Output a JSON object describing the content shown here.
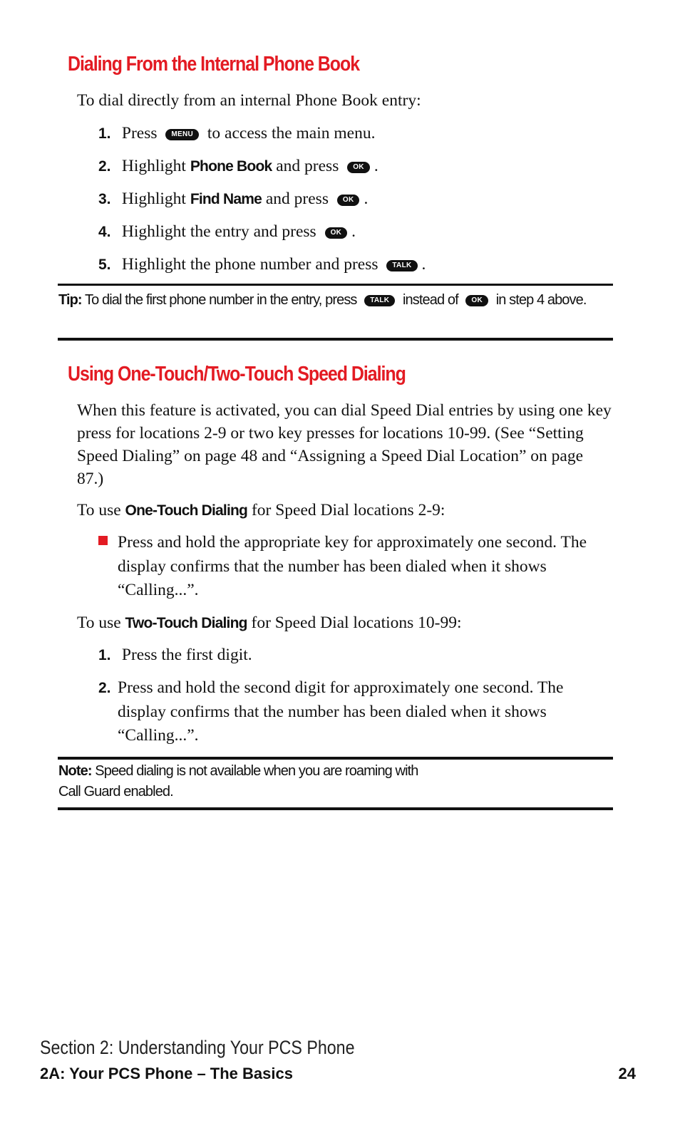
{
  "section1": {
    "heading": "Dialing From the Internal Phone Book",
    "intro": "To dial directly from an internal Phone Book entry:",
    "steps": [
      {
        "num": "1.",
        "pre": "Press",
        "key": "MENU",
        "post": "to access the main menu."
      },
      {
        "num": "2.",
        "pre": "Highlight",
        "bold": "Phone Book",
        "mid": "and press",
        "key": "OK",
        "post": "."
      },
      {
        "num": "3.",
        "pre": "Highlight",
        "bold": "Find Name",
        "mid": "and press",
        "key": "OK",
        "post": "."
      },
      {
        "num": "4.",
        "pre": "Highlight the entry and press",
        "key": "OK",
        "post": "."
      },
      {
        "num": "5.",
        "pre": "Highlight the phone number and press",
        "key": "TALK",
        "post": "."
      }
    ],
    "tip": {
      "label": "Tip:",
      "text1": "To dial the first phone number in the entry, press",
      "key1": "TALK",
      "text2": "instead of",
      "key2": "OK",
      "text3": "in step 4 above."
    }
  },
  "section2": {
    "heading": "Using One-Touch/Two-Touch Speed Dialing",
    "intro": "When this feature is activated, you can dial Speed Dial entries by using one key press for locations 2-9 or two key presses for locations 10-99. (See “Setting Speed Dialing” on page 48 and “Assigning a Speed Dial Location” on page 87.)",
    "one_touch": {
      "pre": "To use",
      "bold": "One-Touch Dialing",
      "post": "for Speed Dial locations 2-9:",
      "bullet": "Press and hold the appropriate key for approximately one second. The display confirms that the number has been dialed when it shows “Calling...”."
    },
    "two_touch": {
      "pre": "To use",
      "bold": "Two-Touch Dialing",
      "post": "for Speed Dial locations 10-99:",
      "steps": [
        {
          "num": "1.",
          "text": "Press the first digit."
        },
        {
          "num": "2.",
          "text": "Press and hold the second digit for approximately one second. The display confirms that the number has been dialed when it shows “Calling...”."
        }
      ]
    },
    "note": {
      "label": "Note:",
      "line1": "Speed dialing is not available when you are roaming with",
      "line2": "Call Guard enabled."
    }
  },
  "footer": {
    "section": "Section 2: Understanding Your PCS Phone",
    "chapter": "2A: Your PCS Phone – The Basics",
    "page": "24"
  },
  "colors": {
    "accent": "#e31b23",
    "text": "#111111"
  }
}
